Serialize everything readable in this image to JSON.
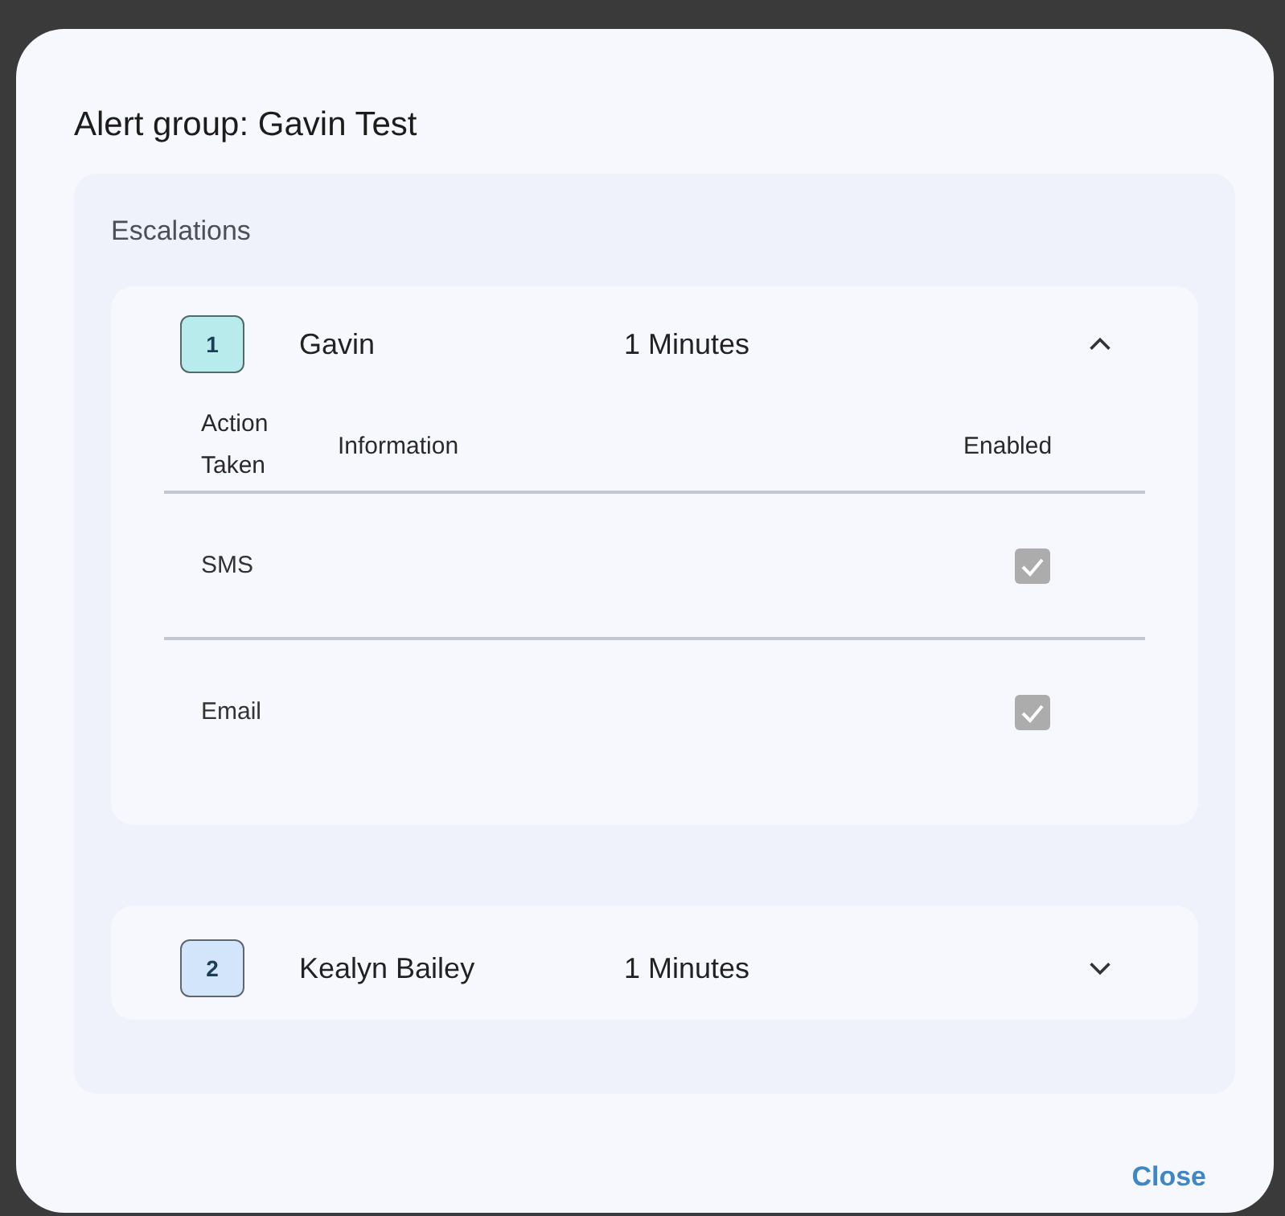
{
  "dialog": {
    "title": "Alert group: Gavin Test"
  },
  "escalations": {
    "label": "Escalations",
    "columns": [
      "Action Taken",
      "Information",
      "Enabled"
    ],
    "steps": [
      {
        "number": "1",
        "color": "#b8ebec",
        "name": "Gavin",
        "delay": "1 Minutes",
        "expanded": true,
        "actions": [
          {
            "action": "SMS",
            "enabled": true
          },
          {
            "action": "Email",
            "enabled": true
          }
        ]
      },
      {
        "number": "2",
        "color": "#d3e5fb",
        "name": "Kealyn Bailey",
        "delay": "1 Minutes",
        "expanded": false
      }
    ]
  },
  "buttons": [
    "Close"
  ]
}
